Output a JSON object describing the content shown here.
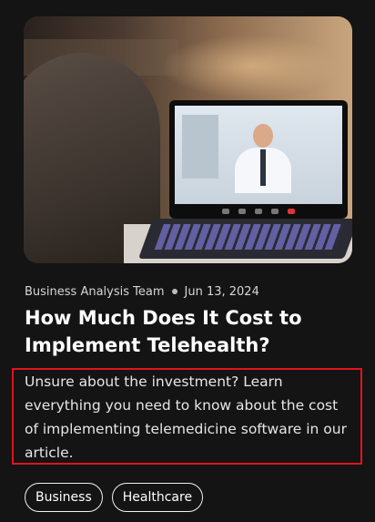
{
  "article": {
    "image_alt": "Patient on a telehealth video call with a doctor on a laptop",
    "author": "Business Analysis Team",
    "date": "Jun 13, 2024",
    "title": "How Much Does It Cost to Implement Telehealth?",
    "excerpt": "Unsure about the investment? Learn everything you need to know about the cost of implementing telemedicine software in our article.",
    "tags": [
      "Business",
      "Healthcare"
    ]
  },
  "colors": {
    "background": "#141414",
    "highlight_border": "#e0141c",
    "text": "#ffffff"
  }
}
